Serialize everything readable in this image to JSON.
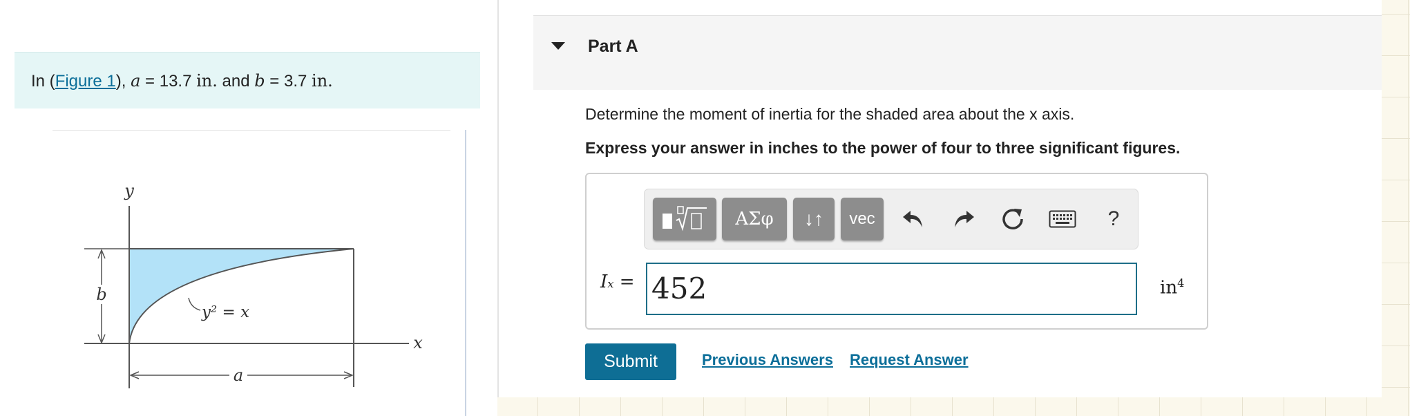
{
  "problem": {
    "prefix": "In (",
    "figure_link": "Figure 1",
    "after_link": "), ",
    "a_symbol": "a",
    "a_eq": " = 13.7 ",
    "a_unit": "in.",
    "and_text": " and ",
    "b_symbol": "b",
    "b_eq": " = 3.7 ",
    "b_unit": "in."
  },
  "figure": {
    "y_axis_label": "y",
    "x_axis_label": "x",
    "b_dimension_label": "b",
    "a_dimension_label": "a",
    "curve_label": "y² = x",
    "shaded_color": "#b3e2f8"
  },
  "part": {
    "title": "Part A",
    "question": "Determine the moment of inertia for the shaded area about the x axis.",
    "instruction": "Express your answer in inches to the power of four to three significant figures."
  },
  "toolbar": {
    "greek_label": "ΑΣφ",
    "arrows_label": "↓↑",
    "vec_label": "vec",
    "help_label": "?"
  },
  "answer": {
    "variable_label": "Iₓ =",
    "value": "452",
    "unit_base": "in",
    "unit_exp": "4"
  },
  "actions": {
    "submit_label": "Submit",
    "previous_answers_label": "Previous Answers",
    "request_answer_label": "Request Answer"
  },
  "colors": {
    "accent": "#0e6e95",
    "link": "#0b6e99",
    "given_bg": "#e5f6f6",
    "toolbar_button": "#8d8d8d"
  }
}
